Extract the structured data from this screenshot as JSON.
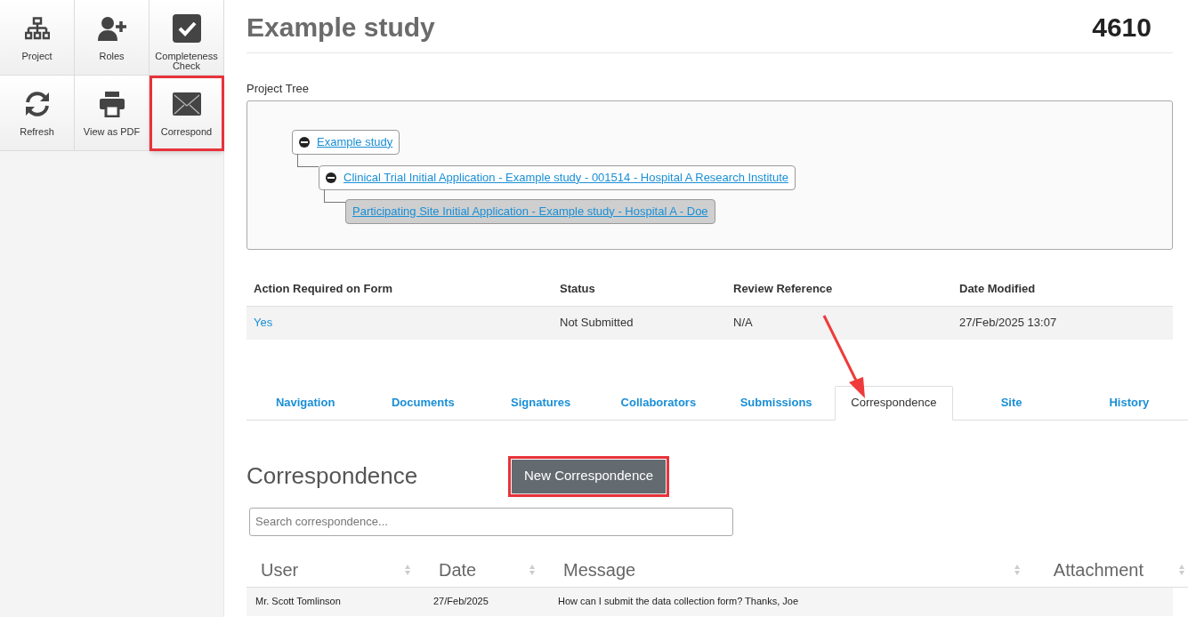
{
  "toolbar": [
    {
      "kind": "project",
      "label": "Project",
      "highlighted": false
    },
    {
      "kind": "roles",
      "label": "Roles",
      "highlighted": false
    },
    {
      "kind": "check",
      "label": "Completeness Check",
      "highlighted": false
    },
    {
      "kind": "refresh",
      "label": "Refresh",
      "highlighted": false
    },
    {
      "kind": "print",
      "label": "View as PDF",
      "highlighted": false
    },
    {
      "kind": "mail",
      "label": "Correspond",
      "highlighted": true
    }
  ],
  "title": "Example study",
  "project_number": "4610",
  "project_tree": {
    "label": "Project Tree",
    "nodes": [
      {
        "label": "Example study",
        "expanded": true,
        "selected": false,
        "children": [
          {
            "label": "Clinical Trial Initial Application - Example study - 001514 - Hospital A Research Institute",
            "expanded": true,
            "selected": false,
            "children": [
              {
                "label": "Participating Site Initial Application - Example study - Hospital A - Doe",
                "selected": true
              }
            ]
          }
        ]
      }
    ]
  },
  "form_table": {
    "columns": [
      "Action Required on Form",
      "Status",
      "Review Reference",
      "Date Modified"
    ],
    "rows": [
      [
        "Yes",
        "Not Submitted",
        "N/A",
        "27/Feb/2025 13:07"
      ]
    ]
  },
  "tabs": [
    {
      "label": "Navigation",
      "selected": false
    },
    {
      "label": "Documents",
      "selected": false
    },
    {
      "label": "Signatures",
      "selected": false
    },
    {
      "label": "Collaborators",
      "selected": false
    },
    {
      "label": "Submissions",
      "selected": false
    },
    {
      "label": "Correspondence",
      "selected": true
    },
    {
      "label": "Site",
      "selected": false
    },
    {
      "label": "History",
      "selected": false
    }
  ],
  "correspondence": {
    "heading": "Correspondence",
    "new_button": {
      "label": "New Correspondence",
      "highlighted": true
    },
    "search": {
      "placeholder": "Search correspondence..."
    },
    "columns": [
      "User",
      "Date",
      "Message",
      "Attachment"
    ],
    "rows": [
      [
        "Mr. Scott Tomlinson",
        "27/Feb/2025",
        "How can I submit the data collection form? Thanks, Joe",
        ""
      ]
    ]
  }
}
